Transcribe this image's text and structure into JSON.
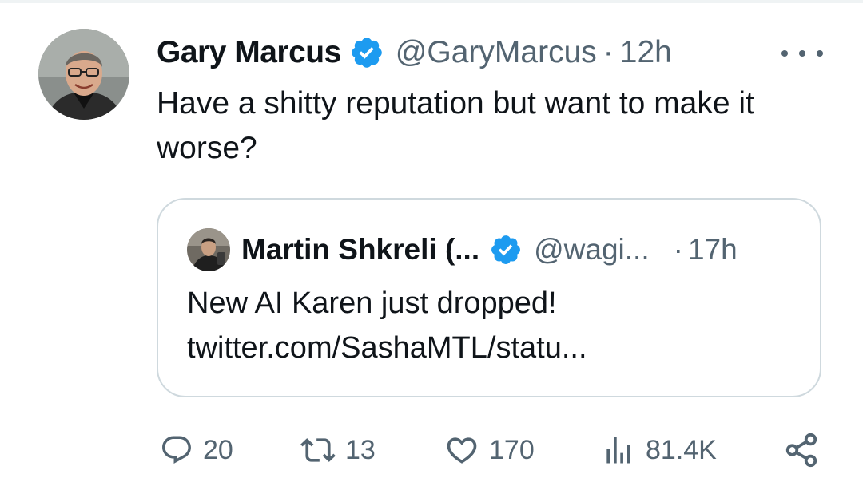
{
  "tweet": {
    "author_name": "Gary Marcus",
    "handle": "@GaryMarcus",
    "separator": "·",
    "time": "12h",
    "text": "Have a shitty reputation but want to make it worse?",
    "more_icon": "more-icon"
  },
  "quoted_tweet": {
    "author_name": "Martin Shkreli (...",
    "handle": "@wagi...",
    "separator": "·",
    "time": "17h",
    "text_line1": "New AI Karen just dropped!",
    "text_line2": "twitter.com/SashaMTL/statu..."
  },
  "actions": {
    "replies": "20",
    "retweets": "13",
    "likes": "170",
    "views": "81.4K"
  },
  "icons": {
    "reply": "reply-icon",
    "retweet": "retweet-icon",
    "like": "heart-icon",
    "views": "views-icon",
    "share": "share-icon",
    "verified": "verified-badge-icon"
  },
  "colors": {
    "text": "#0f1419",
    "muted": "#536471",
    "verified": "#1d9bf0",
    "border": "#cfd9de"
  }
}
